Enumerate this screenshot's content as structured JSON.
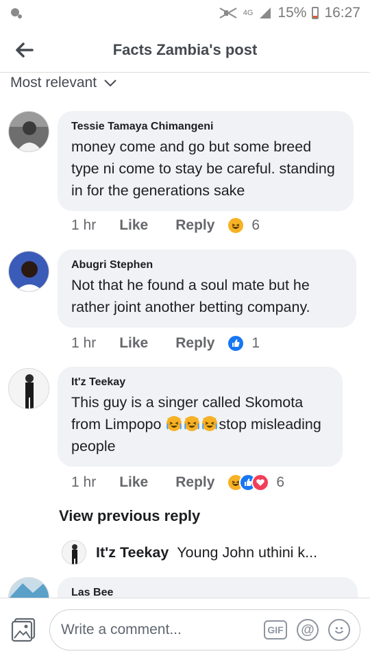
{
  "status_bar": {
    "network": "4G",
    "battery": "15%",
    "time": "16:27"
  },
  "header": {
    "title": "Facts Zambia's post",
    "back_icon": "arrow-left-icon"
  },
  "sort": {
    "label": "Most relevant",
    "icon": "chevron-down-icon"
  },
  "comments": [
    {
      "name": "Tessie Tamaya Chimangeni",
      "text": "money come and go but some breed type ni come to stay be careful. standing in for the generations sake",
      "time": "1 hr",
      "like_label": "Like",
      "reply_label": "Reply",
      "reaction_count": "6"
    },
    {
      "name": "Abugri Stephen",
      "text": "Not that he found a soul mate but he rather joint another betting company.",
      "time": "1 hr",
      "like_label": "Like",
      "reply_label": "Reply",
      "reaction_count": "1"
    },
    {
      "name": "It'z Teekay",
      "text_part1": "This guy is a singer called Skomota from Limpopo ",
      "text_part2": "stop misleading people",
      "time": "1 hr",
      "like_label": "Like",
      "reply_label": "Reply",
      "reaction_count": "6"
    },
    {
      "name": "Las Bee"
    }
  ],
  "view_previous_reply": "View previous reply",
  "reply_preview": {
    "name": "It'z Teekay",
    "text": "Young John uthini k..."
  },
  "composer": {
    "placeholder": "Write a comment...",
    "gif_label": "GIF",
    "at_label": "@"
  }
}
